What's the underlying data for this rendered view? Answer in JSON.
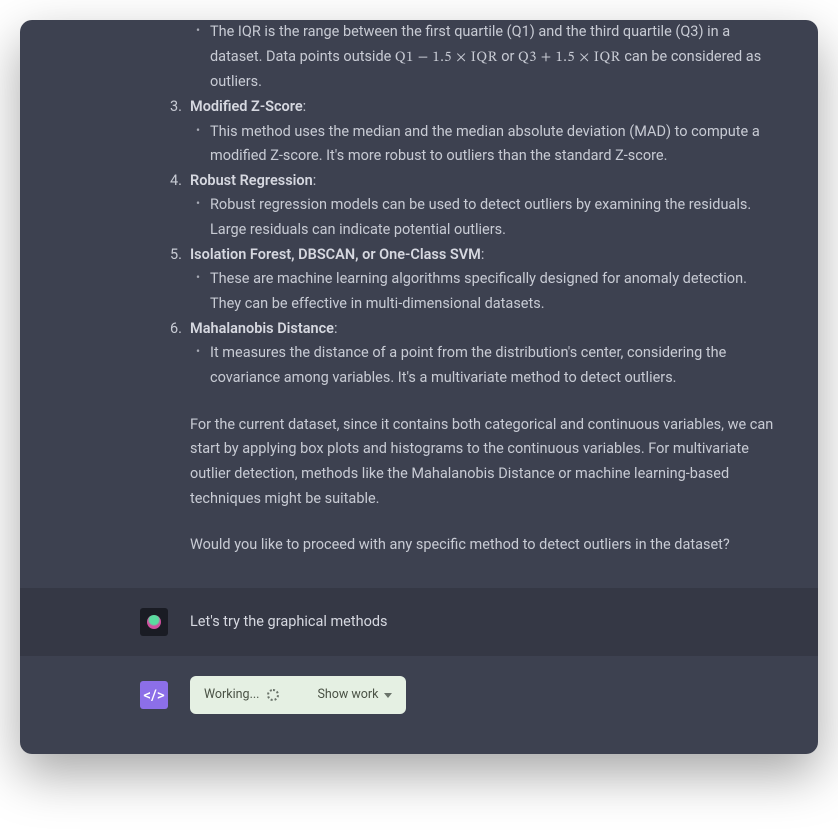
{
  "assistant": {
    "iqr_bullet_pre": "The IQR is the range between the first quartile (Q1) and the third quartile (Q3) in a dataset. Data points outside ",
    "iqr_formula_1": "Q1 − 1.5 × IQR",
    "iqr_or": " or ",
    "iqr_formula_2": "Q3 + 1.5 × IQR",
    "iqr_bullet_post": " can be considered as outliers.",
    "items": [
      {
        "num": "3.",
        "title": "Modified Z-Score",
        "bullet": "This method uses the median and the median absolute deviation (MAD) to compute a modified Z-score. It's more robust to outliers than the standard Z-score."
      },
      {
        "num": "4.",
        "title": "Robust Regression",
        "bullet": "Robust regression models can be used to detect outliers by examining the residuals. Large residuals can indicate potential outliers."
      },
      {
        "num": "5.",
        "title": "Isolation Forest, DBSCAN, or One-Class SVM",
        "bullet": "These are machine learning algorithms specifically designed for anomaly detection. They can be effective in multi-dimensional datasets."
      },
      {
        "num": "6.",
        "title": "Mahalanobis Distance",
        "bullet": "It measures the distance of a point from the distribution's center, considering the covariance among variables. It's a multivariate method to detect outliers."
      }
    ],
    "para1": "For the current dataset, since it contains both categorical and continuous variables, we can start by applying box plots and histograms to the continuous variables. For multivariate outlier detection, methods like the Mahalanobis Distance or machine learning-based techniques might be suitable.",
    "para2": "Would you like to proceed with any specific method to detect outliers in the dataset?"
  },
  "user": {
    "text": "Let's try the graphical methods"
  },
  "working": {
    "code_glyph": "</>",
    "status": "Working...",
    "show_work": "Show work"
  }
}
